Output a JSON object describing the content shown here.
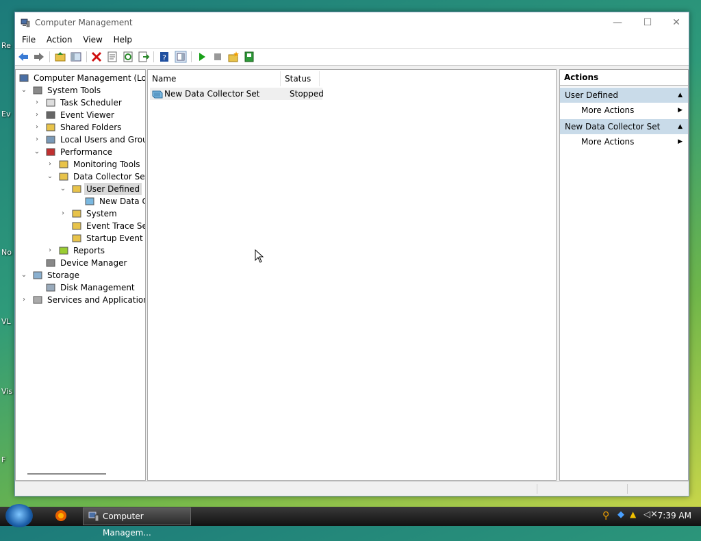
{
  "window": {
    "title": "Computer Management"
  },
  "menu": [
    "File",
    "Action",
    "View",
    "Help"
  ],
  "tree": [
    {
      "label": "Computer Management (Local",
      "icon": "computer-icon",
      "expander": "",
      "depth": 0,
      "selected": false
    },
    {
      "label": "System Tools",
      "icon": "tools-icon",
      "expander": "expanded",
      "depth": 1,
      "selected": false
    },
    {
      "label": "Task Scheduler",
      "icon": "clock-icon",
      "expander": "collapsed",
      "depth": 2,
      "selected": false
    },
    {
      "label": "Event Viewer",
      "icon": "event-viewer-icon",
      "expander": "collapsed",
      "depth": 2,
      "selected": false
    },
    {
      "label": "Shared Folders",
      "icon": "shared-folder-icon",
      "expander": "collapsed",
      "depth": 2,
      "selected": false
    },
    {
      "label": "Local Users and Groups",
      "icon": "users-icon",
      "expander": "collapsed",
      "depth": 2,
      "selected": false
    },
    {
      "label": "Performance",
      "icon": "performance-icon",
      "expander": "expanded",
      "depth": 2,
      "selected": false
    },
    {
      "label": "Monitoring Tools",
      "icon": "folder-icon",
      "expander": "collapsed",
      "depth": 3,
      "selected": false
    },
    {
      "label": "Data Collector Sets",
      "icon": "folder-icon",
      "expander": "expanded",
      "depth": 3,
      "selected": false
    },
    {
      "label": "User Defined",
      "icon": "user-folder-icon",
      "expander": "expanded",
      "depth": 4,
      "selected": true
    },
    {
      "label": "New Data Co",
      "icon": "data-collector-icon",
      "expander": "",
      "depth": 5,
      "selected": false
    },
    {
      "label": "System",
      "icon": "folder-icon",
      "expander": "collapsed",
      "depth": 4,
      "selected": false
    },
    {
      "label": "Event Trace Sess",
      "icon": "folder-icon",
      "expander": "",
      "depth": 4,
      "selected": false
    },
    {
      "label": "Startup Event Tra",
      "icon": "folder-icon",
      "expander": "",
      "depth": 4,
      "selected": false
    },
    {
      "label": "Reports",
      "icon": "reports-folder-icon",
      "expander": "collapsed",
      "depth": 3,
      "selected": false
    },
    {
      "label": "Device Manager",
      "icon": "device-manager-icon",
      "expander": "",
      "depth": 2,
      "selected": false
    },
    {
      "label": "Storage",
      "icon": "storage-icon",
      "expander": "expanded",
      "depth": 1,
      "selected": false
    },
    {
      "label": "Disk Management",
      "icon": "disk-icon",
      "expander": "",
      "depth": 2,
      "selected": false
    },
    {
      "label": "Services and Applications",
      "icon": "services-icon",
      "expander": "collapsed",
      "depth": 1,
      "selected": false
    }
  ],
  "list": {
    "columns": [
      "Name",
      "Status"
    ],
    "rows": [
      {
        "name": "New Data Collector Set",
        "status": "Stopped"
      }
    ]
  },
  "actions": {
    "title": "Actions",
    "sections": [
      {
        "title": "User Defined",
        "items": [
          "More Actions"
        ]
      },
      {
        "title": "New Data Collector Set",
        "items": [
          "More Actions"
        ]
      }
    ]
  },
  "taskbar": {
    "app_label": "Computer Managem...",
    "clock": "7:39 AM"
  },
  "desktop_labels": [
    "Re",
    "Ev",
    "No",
    "VL",
    "Vis",
    "F"
  ]
}
